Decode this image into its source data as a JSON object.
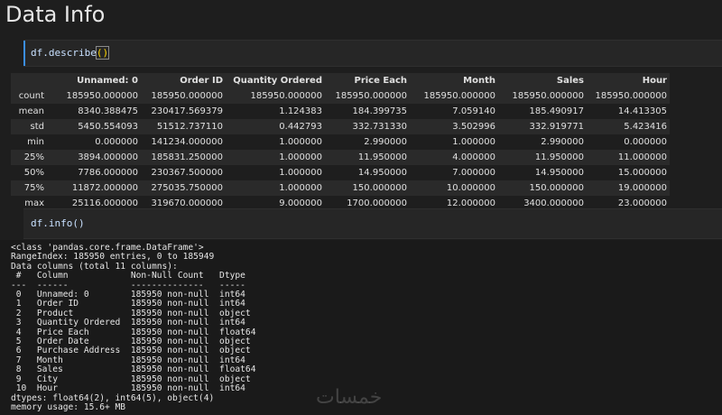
{
  "markdown": {
    "title": "Data Info"
  },
  "cell1": {
    "code_prefix": "df.describe",
    "code_paren": "()"
  },
  "table": {
    "columns": [
      "Unnamed: 0",
      "Order ID",
      "Quantity Ordered",
      "Price Each",
      "Month",
      "Sales",
      "Hour"
    ],
    "rows": [
      {
        "label": "count",
        "values": [
          "185950.000000",
          "185950.000000",
          "185950.000000",
          "185950.000000",
          "185950.000000",
          "185950.000000",
          "185950.000000"
        ]
      },
      {
        "label": "mean",
        "values": [
          "8340.388475",
          "230417.569379",
          "1.124383",
          "184.399735",
          "7.059140",
          "185.490917",
          "14.413305"
        ]
      },
      {
        "label": "std",
        "values": [
          "5450.554093",
          "51512.737110",
          "0.442793",
          "332.731330",
          "3.502996",
          "332.919771",
          "5.423416"
        ]
      },
      {
        "label": "min",
        "values": [
          "0.000000",
          "141234.000000",
          "1.000000",
          "2.990000",
          "1.000000",
          "2.990000",
          "0.000000"
        ]
      },
      {
        "label": "25%",
        "values": [
          "3894.000000",
          "185831.250000",
          "1.000000",
          "11.950000",
          "4.000000",
          "11.950000",
          "11.000000"
        ]
      },
      {
        "label": "50%",
        "values": [
          "7786.000000",
          "230367.500000",
          "1.000000",
          "14.950000",
          "7.000000",
          "14.950000",
          "15.000000"
        ]
      },
      {
        "label": "75%",
        "values": [
          "11872.000000",
          "275035.750000",
          "1.000000",
          "150.000000",
          "10.000000",
          "150.000000",
          "19.000000"
        ]
      },
      {
        "label": "max",
        "values": [
          "25116.000000",
          "319670.000000",
          "9.000000",
          "1700.000000",
          "12.000000",
          "3400.000000",
          "23.000000"
        ]
      }
    ]
  },
  "cell2": {
    "code": "df.info()"
  },
  "info_output": {
    "lines": [
      "<class 'pandas.core.frame.DataFrame'>",
      "RangeIndex: 185950 entries, 0 to 185949",
      "Data columns (total 11 columns):",
      " #   Column            Non-Null Count   Dtype  ",
      "---  ------            --------------   -----  ",
      " 0   Unnamed: 0        185950 non-null  int64  ",
      " 1   Order ID          185950 non-null  int64  ",
      " 2   Product           185950 non-null  object ",
      " 3   Quantity Ordered  185950 non-null  int64  ",
      " 4   Price Each        185950 non-null  float64",
      " 5   Order Date        185950 non-null  object ",
      " 6   Purchase Address  185950 non-null  object ",
      " 7   Month             185950 non-null  int64  ",
      " 8   Sales             185950 non-null  float64",
      " 9   City              185950 non-null  object ",
      " 10  Hour              185950 non-null  int64  ",
      "dtypes: float64(2), int64(5), object(4)",
      "memory usage: 15.6+ MB"
    ]
  },
  "watermark": "خمسات"
}
